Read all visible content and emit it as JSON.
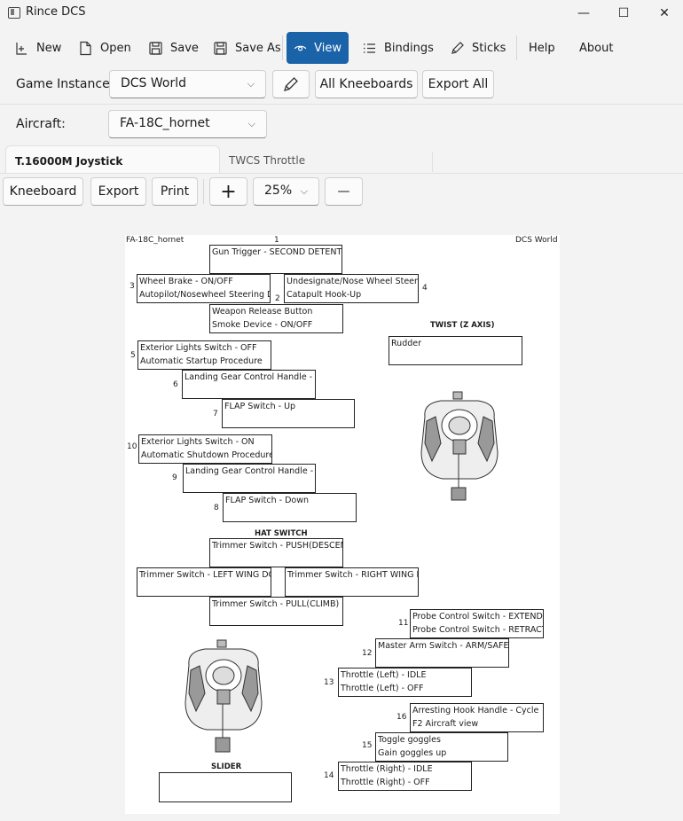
{
  "window": {
    "title": "Rince DCS",
    "minimize": "—",
    "maximize": "☐",
    "close": "✕"
  },
  "toolbar": {
    "new": "New",
    "open": "Open",
    "save": "Save",
    "save_as": "Save As",
    "view": "View",
    "bindings": "Bindings",
    "sticks": "Sticks",
    "help": "Help",
    "about": "About"
  },
  "instance": {
    "label": "Game Instance:",
    "selected": "DCS World",
    "all_kneeboards": "All Kneeboards",
    "export_all": "Export All"
  },
  "aircraft": {
    "label": "Aircraft:",
    "selected": "FA-18C_hornet"
  },
  "tabs": [
    {
      "label": "T.16000M Joystick"
    },
    {
      "label": "TWCS Throttle"
    }
  ],
  "viewbar": {
    "kneeboard": "Kneeboard",
    "export": "Export",
    "print": "Print",
    "zoom_in": "+",
    "zoom": "25%",
    "zoom_out": "—"
  },
  "sheet": {
    "aircraft": "FA-18C_hornet",
    "game": "DCS World",
    "twist_caption": "TWIST (Z AXIS)",
    "hat_caption": "HAT SWITCH",
    "slider_caption": "SLIDER",
    "numbers": {
      "n1": "1",
      "n2": "2",
      "n3": "3",
      "n4": "4",
      "n5": "5",
      "n6": "6",
      "n7": "7",
      "n8": "8",
      "n9": "9",
      "n10": "10",
      "n11": "11",
      "n12": "12",
      "n13": "13",
      "n14": "14",
      "n15": "15",
      "n16": "16"
    },
    "bindings": {
      "b1": [
        "Gun Trigger - SECOND DETENT (P"
      ],
      "b2": [
        "Weapon Release Button",
        "Smoke Device - ON/OFF"
      ],
      "b3": [
        "Wheel Brake - ON/OFF",
        "Autopilot/Nosewheel Steering Dis"
      ],
      "b4": [
        "Undesignate/Nose Wheel Steer Sw",
        "Catapult Hook-Up"
      ],
      "b5": [
        "Exterior Lights Switch - OFF",
        "Automatic Startup Procedure"
      ],
      "b6": [
        "Landing Gear Control Handle - UP"
      ],
      "b7": [
        "FLAP Switch - Up"
      ],
      "b8": [
        "FLAP Switch - Down"
      ],
      "b9": [
        "Landing Gear Control Handle - DO"
      ],
      "b10": [
        "Exterior Lights Switch - ON",
        "Automatic Shutdown Procedure"
      ],
      "twist": [
        "Rudder"
      ],
      "hat_up": [
        "Trimmer Switch - PUSH(DESCEND"
      ],
      "hat_left": [
        "Trimmer Switch - LEFT WING DOW"
      ],
      "hat_right": [
        "Trimmer Switch - RIGHT WING DO"
      ],
      "hat_down": [
        "Trimmer Switch - PULL(CLIMB)"
      ],
      "t11": [
        "Probe Control Switch - EXTEND",
        "Probe Control Switch - RETRACT"
      ],
      "t12": [
        "Master Arm Switch - ARM/SAFE"
      ],
      "t13": [
        "Throttle (Left) - IDLE",
        "Throttle (Left) - OFF"
      ],
      "t16": [
        "Arresting Hook Handle - Cycle",
        "F2 Aircraft view"
      ],
      "t15": [
        "Toggle goggles",
        "Gain goggles up"
      ],
      "t14": [
        "Throttle (Right) - IDLE",
        "Throttle (Right) - OFF"
      ],
      "slider": []
    }
  },
  "colors": {
    "accent": "#1a63a9"
  }
}
